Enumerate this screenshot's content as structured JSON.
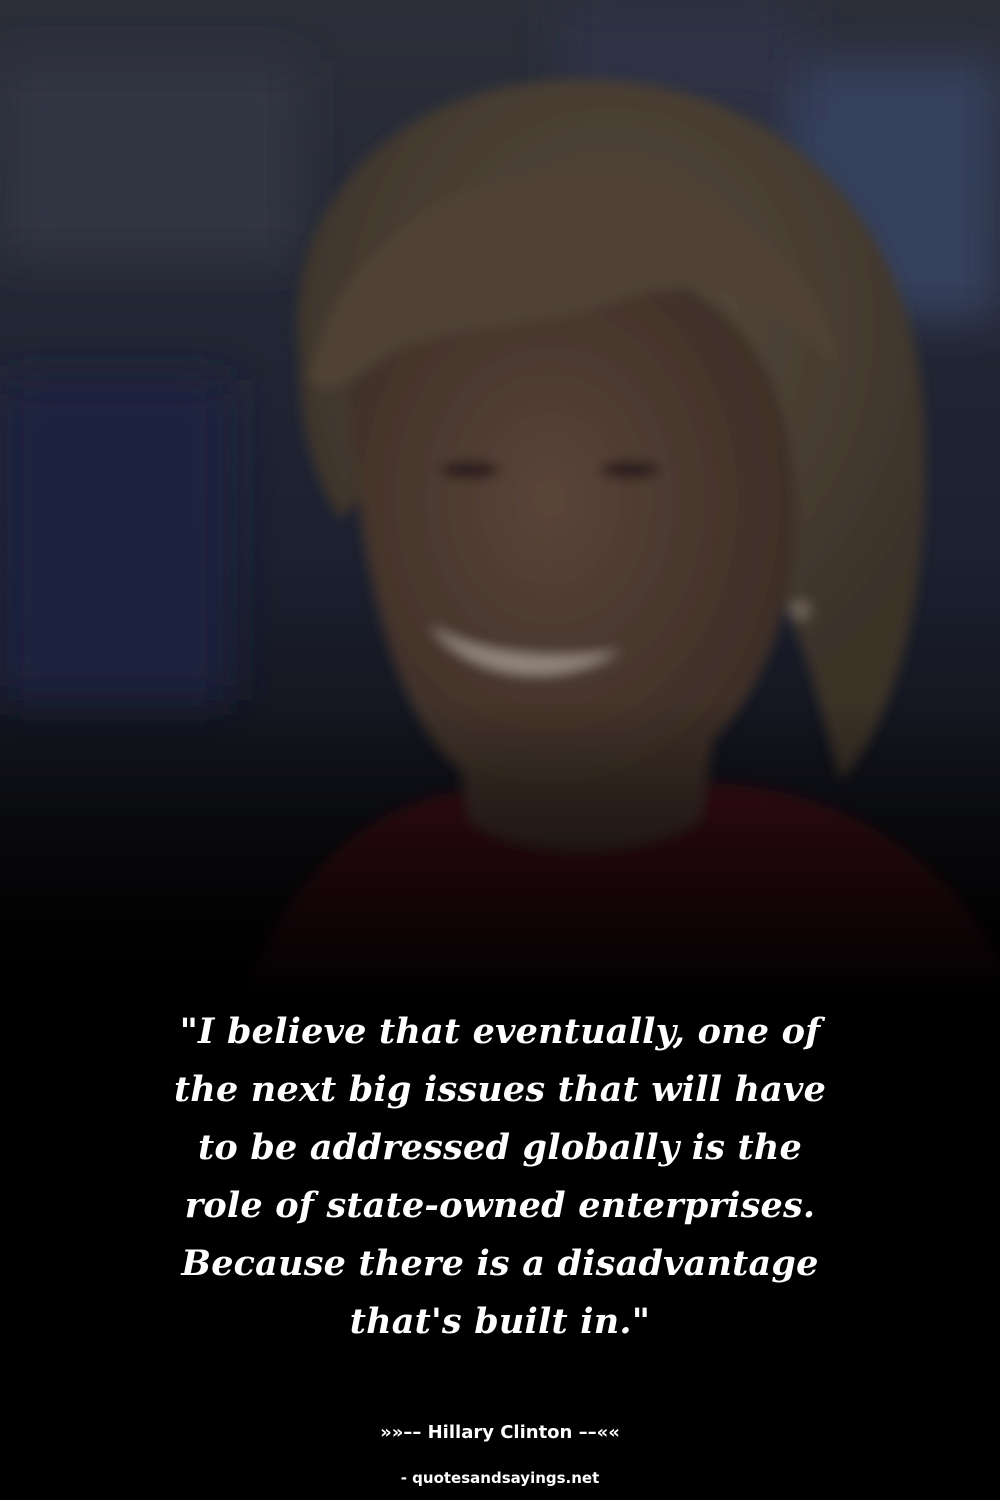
{
  "quote": {
    "text": "\"I believe that eventually, one of\nthe next big issues that will have\nto be addressed globally is the\nrole of state-owned enterprises.\nBecause there is a disadvantage\nthat's built in.\""
  },
  "attribution": {
    "author_line": "»»–– Hillary Clinton ––««"
  },
  "footer": {
    "source": "- quotesandsayings.net"
  },
  "colors": {
    "background": "#000000",
    "text": "#ffffff",
    "jacket": "#3a0e12",
    "hair": "#4a3f33",
    "skin": "#4b3a31",
    "backdrop_blue": "#1b2034"
  }
}
